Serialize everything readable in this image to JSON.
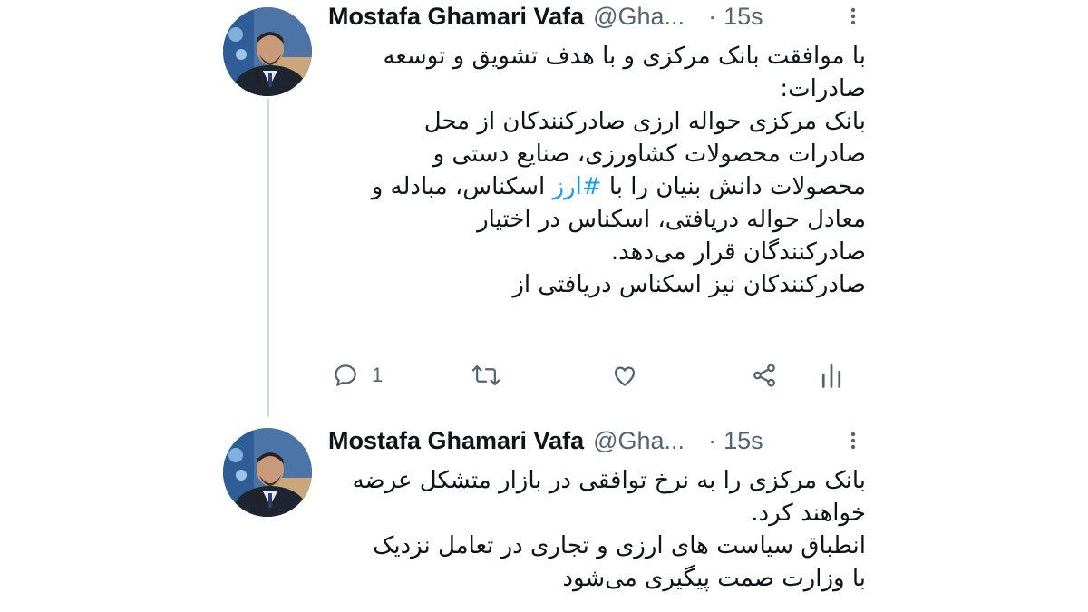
{
  "tweets": [
    {
      "author_name": "Mostafa Ghamari Vafa",
      "handle": "@Gha...",
      "dot": "·",
      "time": "15s",
      "lines": [
        "با موافقت بانک مرکزی و با هدف تشویق و توسعه",
        "صادرات:",
        "بانک مرکزی حواله ارزی صادرکنندکان از محل",
        "صادرات محصولات کشاورزی، صنایع دستی و",
        "معادل حواله دریافتی، اسکناس در اختیار",
        "صادرکنندگان قرار می‌دهد.",
        "صادرکنندکان نیز اسکناس دریافتی از"
      ],
      "hashtag_line": {
        "before": "محصولات دانش بنیان را با ",
        "hashtag": "#ارز",
        "after": " اسکناس، مبادله و"
      },
      "reply_count": "1",
      "icons": [
        "reply-icon",
        "retweet-icon",
        "like-icon",
        "share-icon",
        "analytics-icon",
        "more-icon"
      ]
    },
    {
      "author_name": "Mostafa Ghamari Vafa",
      "handle": "@Gha...",
      "dot": "·",
      "time": "15s",
      "lines": [
        "بانک مرکزی را به نرخ توافقی در بازار متشکل عرضه",
        "خواهند کرد.",
        "انطباق سیاست های ارزی و تجاری در تعامل نزدیک",
        "با وزارت صمت پیگیری می‌شود"
      ]
    }
  ],
  "colors": {
    "text": "#0f1419",
    "secondary": "#536471",
    "hashtag": "#1d9bf0",
    "thread_line": "#cfd9de"
  }
}
